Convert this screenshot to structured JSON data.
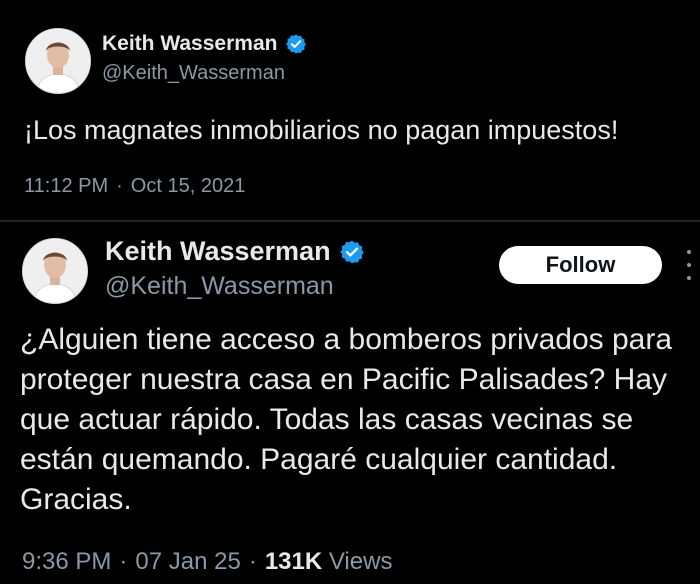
{
  "tweet1": {
    "author_name": "Keith Wasserman",
    "handle": "@Keith_Wasserman",
    "text": "¡Los magnates inmobiliarios no pagan impuestos!",
    "time": "11:12 PM",
    "separator": "·",
    "date": "Oct 15, 2021"
  },
  "tweet2": {
    "author_name": "Keith Wasserman",
    "handle": "@Keith_Wasserman",
    "follow_label": "Follow",
    "text": "¿Alguien tiene acceso a bomberos privados para proteger nuestra casa en Pacific Palisades? Hay que actuar rápido. Todas las casas vecinas se están quemando. Pagaré cualquier cantidad. Gracias.",
    "time": "9:36 PM",
    "separator": "·",
    "date": "07 Jan 25",
    "views_count": "131K",
    "views_label": "Views"
  },
  "icons": {
    "verified": "verified-badge-icon",
    "more": "more-options-icon"
  },
  "colors": {
    "background": "#000000",
    "text_primary": "#e7e9ea",
    "text_secondary": "#8b98a5",
    "verified_blue": "#1d9bf0",
    "follow_bg": "#ffffff"
  }
}
